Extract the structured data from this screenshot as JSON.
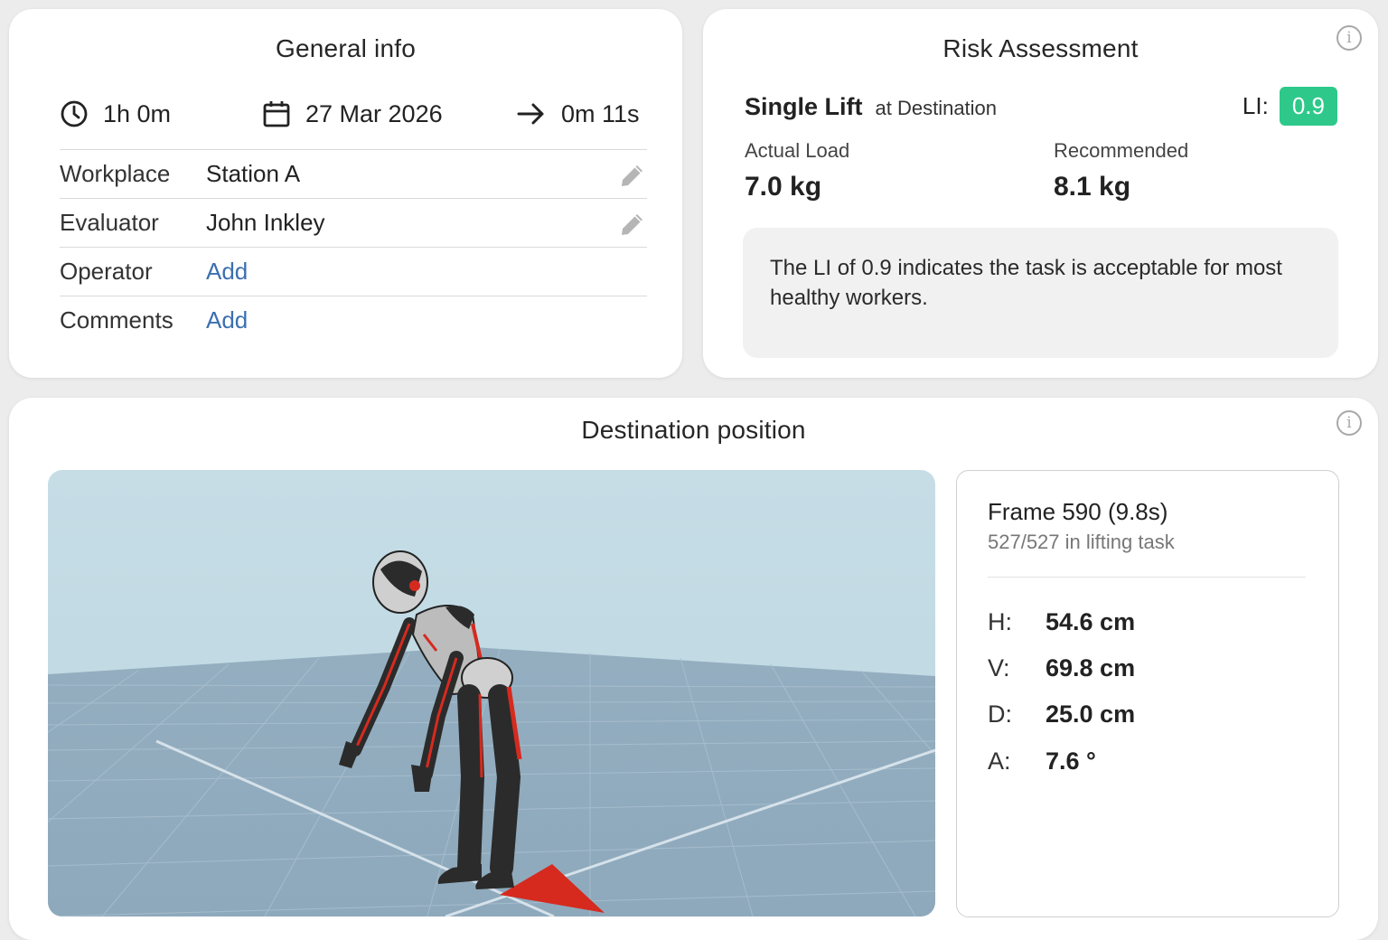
{
  "general": {
    "title": "General info",
    "duration": "1h 0m",
    "date": "27 Mar 2026",
    "elapsed": "0m 11s",
    "rows": [
      {
        "label": "Workplace",
        "value": "Station A"
      },
      {
        "label": "Evaluator",
        "value": "John Inkley"
      },
      {
        "label": "Operator",
        "value": "Add"
      },
      {
        "label": "Comments",
        "value": "Add"
      }
    ]
  },
  "risk": {
    "title": "Risk Assessment",
    "lift_type": "Single Lift",
    "lift_location": "at Destination",
    "li_label": "LI:",
    "li_value": "0.9",
    "li_color": "#2ec98a",
    "actual_load_label": "Actual Load",
    "actual_load_value": "7.0 kg",
    "recommended_label": "Recommended",
    "recommended_value": "8.1 kg",
    "note": "The LI of 0.9 indicates the task is acceptable for most healthy workers."
  },
  "destination": {
    "title": "Destination position",
    "frame_title": "Frame 590 (9.8s)",
    "frame_sub": "527/527 in lifting task",
    "measures": [
      {
        "label": "H:",
        "value": "54.6 cm"
      },
      {
        "label": "V:",
        "value": "69.8 cm"
      },
      {
        "label": "D:",
        "value": "25.0 cm"
      },
      {
        "label": "A:",
        "value": "7.6 °"
      }
    ]
  },
  "icons": {
    "info": "info-icon",
    "clock": "clock-icon",
    "calendar": "calendar-icon",
    "arrow": "arrow-right-icon",
    "edit": "pencil-icon"
  },
  "colors": {
    "accent_link": "#3c6fb0",
    "li_badge": "#2ec98a",
    "mannequin_accent": "#d62a1f"
  }
}
